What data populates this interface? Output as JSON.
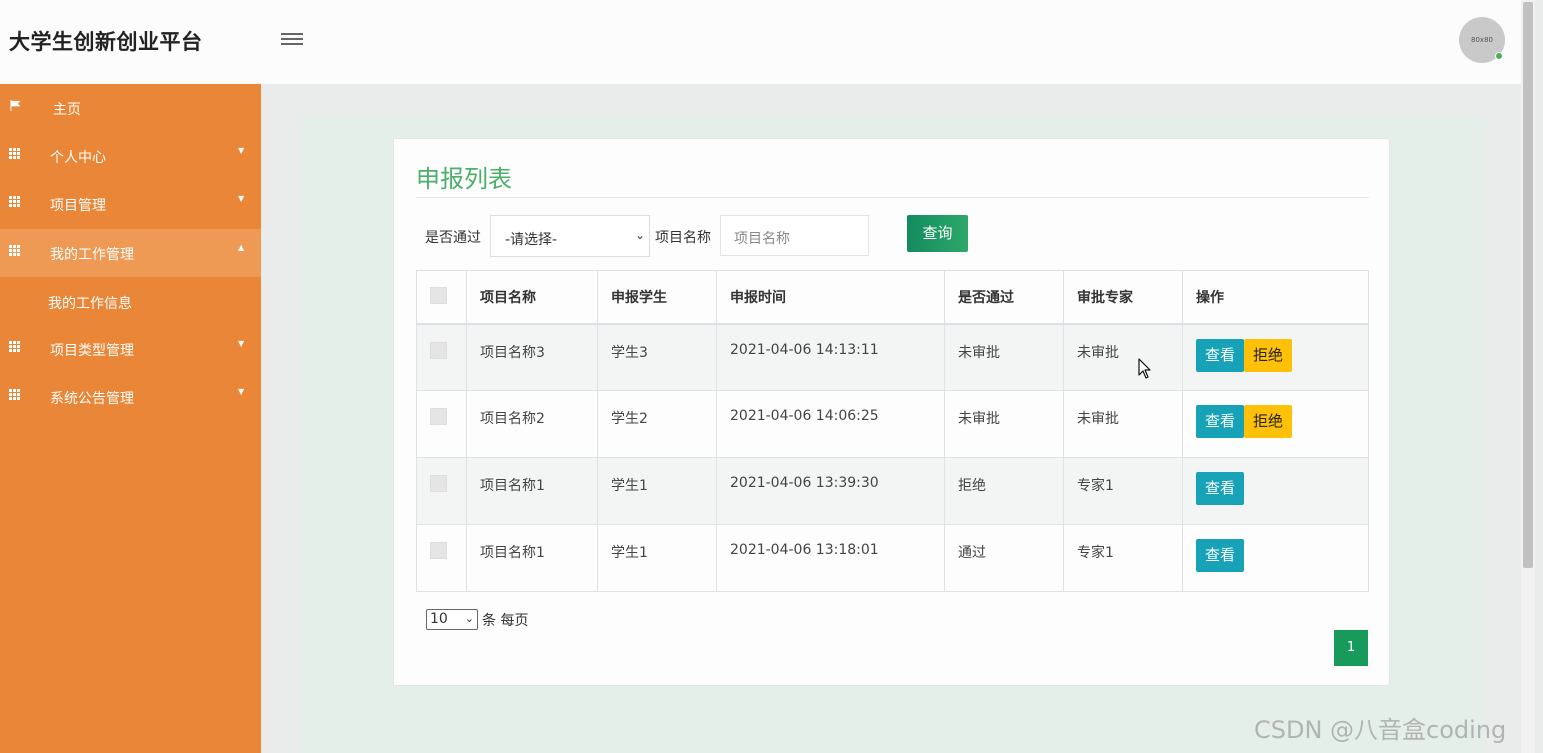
{
  "app": {
    "title": "大学生创新创业平台",
    "avatar_text": "80x80"
  },
  "sidebar": {
    "items": [
      {
        "label": "主页",
        "icon": "flag-icon"
      },
      {
        "label": "个人中心",
        "icon": "grid-icon"
      },
      {
        "label": "项目管理",
        "icon": "grid-icon"
      },
      {
        "label": "我的工作管理",
        "icon": "grid-icon"
      },
      {
        "label": "项目类型管理",
        "icon": "grid-icon"
      },
      {
        "label": "系统公告管理",
        "icon": "grid-icon"
      }
    ],
    "active_sub_item": "我的工作信息"
  },
  "page": {
    "title": "申报列表",
    "filters": {
      "passed_label": "是否通过",
      "passed_value": "-请选择-",
      "name_label": "项目名称",
      "name_placeholder": "项目名称",
      "search_button": "查询"
    },
    "table": {
      "columns": [
        "项目名称",
        "申报学生",
        "申报时间",
        "是否通过",
        "审批专家",
        "操作"
      ],
      "rows": [
        {
          "name": "项目名称3",
          "student": "学生3",
          "time": "2021-04-06 14:13:11",
          "passed": "未审批",
          "expert": "未审批",
          "actions": [
            "查看",
            "拒绝"
          ]
        },
        {
          "name": "项目名称2",
          "student": "学生2",
          "time": "2021-04-06 14:06:25",
          "passed": "未审批",
          "expert": "未审批",
          "actions": [
            "查看",
            "拒绝"
          ]
        },
        {
          "name": "项目名称1",
          "student": "学生1",
          "time": "2021-04-06 13:39:30",
          "passed": "拒绝",
          "expert": "专家1",
          "actions": [
            "查看"
          ]
        },
        {
          "name": "项目名称1",
          "student": "学生1",
          "time": "2021-04-06 13:18:01",
          "passed": "通过",
          "expert": "专家1",
          "actions": [
            "查看"
          ]
        }
      ]
    },
    "pagination": {
      "page_size": "10",
      "page_size_label": "条 每页",
      "current_page": "1"
    }
  },
  "watermark": "CSDN @八音盒coding",
  "colors": {
    "sidebar": "#ea8637",
    "accent_green": "#4caf6a",
    "view_button": "#17a2b8",
    "reject_button": "#ffc107"
  }
}
